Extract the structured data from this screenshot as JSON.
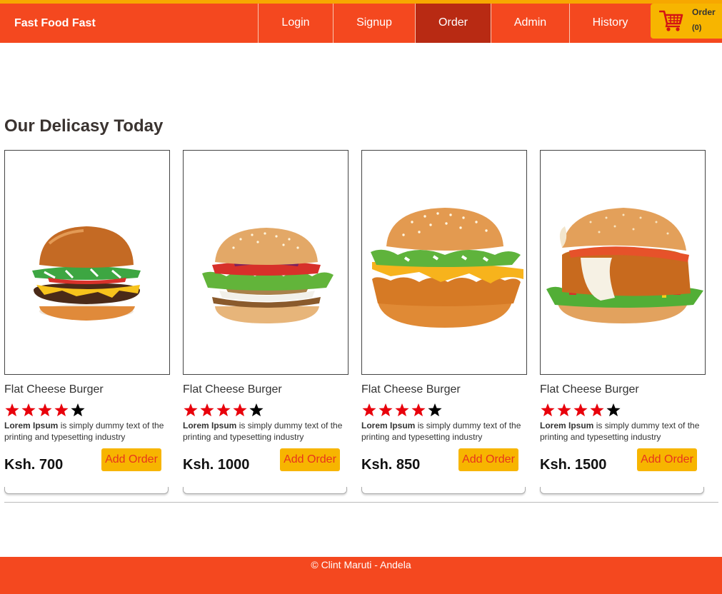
{
  "nav": {
    "brand": "Fast Food Fast",
    "items": [
      {
        "label": "Login"
      },
      {
        "label": "Signup"
      },
      {
        "label": "Order"
      },
      {
        "label": "Admin"
      },
      {
        "label": "History"
      }
    ],
    "active": "Order",
    "cart": {
      "label": "Order",
      "count": "(0)",
      "icon": "cart-icon"
    }
  },
  "section": {
    "title": "Our Delicasy Today"
  },
  "products": [
    {
      "name": "Flat Cheese Burger",
      "rating": 4,
      "max_rating": 5,
      "desc_bold": "Lorem Ipsum",
      "desc_rest": " is simply dummy text of the printing and typesetting industry",
      "price": "Ksh. 700",
      "button": "Add Order"
    },
    {
      "name": "Flat Cheese Burger",
      "rating": 4,
      "max_rating": 5,
      "desc_bold": "Lorem Ipsum",
      "desc_rest": " is simply dummy text of the printing and typesetting industry",
      "price": "Ksh. 1000",
      "button": "Add Order"
    },
    {
      "name": "Flat Cheese Burger",
      "rating": 4,
      "max_rating": 5,
      "desc_bold": "Lorem Ipsum",
      "desc_rest": " is simply dummy text of the printing and typesetting industry",
      "price": "Ksh. 850",
      "button": "Add Order"
    },
    {
      "name": "Flat Cheese Burger",
      "rating": 4,
      "max_rating": 5,
      "desc_bold": "Lorem Ipsum",
      "desc_rest": " is simply dummy text of the printing and typesetting industry",
      "price": "Ksh. 1500",
      "button": "Add Order"
    }
  ],
  "footer": {
    "text": "© Clint Maruti - Andela"
  },
  "colors": {
    "brand": "#f4481f",
    "active_nav": "#b82a13",
    "accent": "#f7b500",
    "star_filled": "#e8000b",
    "star_empty": "#000000"
  }
}
